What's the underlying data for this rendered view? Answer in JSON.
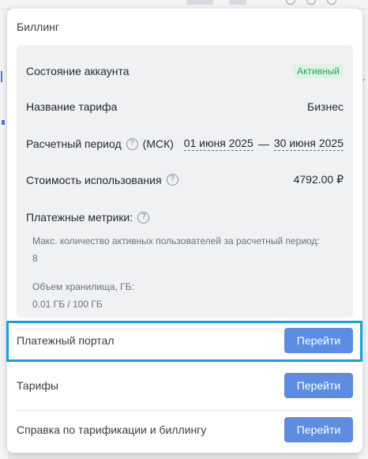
{
  "billing": {
    "title": "Биллинг",
    "account_status": {
      "label": "Состояние аккаунта",
      "value": "Активный",
      "color": "#20a45a"
    },
    "plan_name": {
      "label": "Название тарифа",
      "value": "Бизнес"
    },
    "billing_period": {
      "label": "Расчетный период",
      "timezone": "(МСК)",
      "start": "01 июня 2025",
      "separator": "—",
      "end": "30 июня 2025"
    },
    "usage_cost": {
      "label": "Стоимость использования",
      "value": "4792.00 ₽"
    },
    "metrics": {
      "label": "Платежные метрики:",
      "items": [
        {
          "label": "Макс. количество активных пользователей за расчетный период:",
          "value": "8"
        },
        {
          "label": "Объем хранилища, ГБ:",
          "value": "0.01 ГБ / 100 ГБ"
        }
      ]
    }
  },
  "links": [
    {
      "label": "Платежный портал",
      "button": "Перейти"
    },
    {
      "label": "Тарифы",
      "button": "Перейти"
    },
    {
      "label": "Справка по тарификации и биллингу",
      "button": "Перейти"
    }
  ],
  "colors": {
    "accent": "#5c8de3",
    "highlight": "#12a3e0"
  }
}
